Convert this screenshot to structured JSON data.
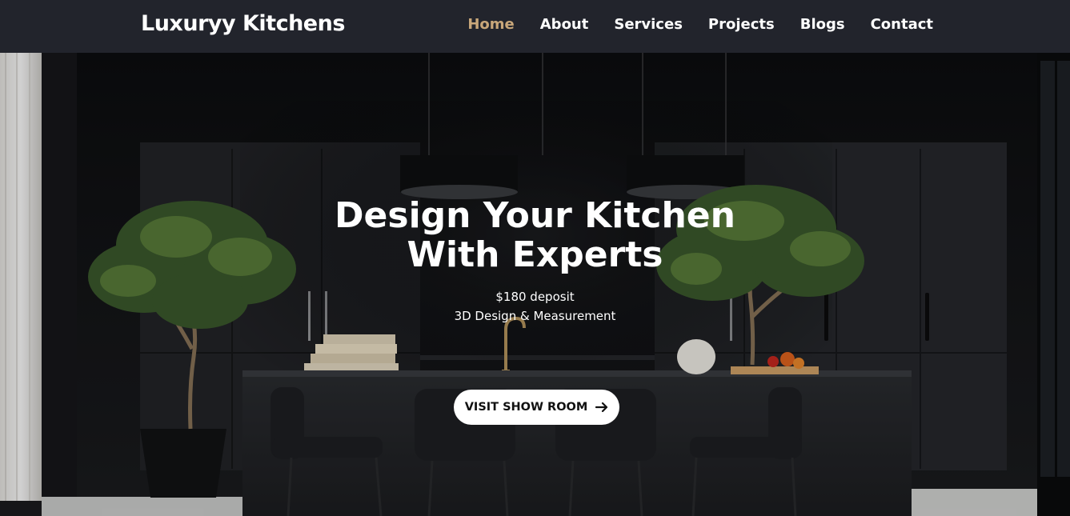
{
  "header": {
    "brand": "Luxuryy Kitchens",
    "nav": [
      {
        "label": "Home",
        "active": true
      },
      {
        "label": "About",
        "active": false
      },
      {
        "label": "Services",
        "active": false
      },
      {
        "label": "Projects",
        "active": false
      },
      {
        "label": "Blogs",
        "active": false
      },
      {
        "label": "Contact",
        "active": false
      }
    ]
  },
  "hero": {
    "title_line1": "Design Your Kitchen",
    "title_line2": "With Experts",
    "subtitle_line1": "$180 deposit",
    "subtitle_line2": "3D Design & Measurement",
    "cta_label": "VISIT SHOW ROOM",
    "cta_icon": "arrow-right-icon"
  },
  "colors": {
    "header_bg": "#22242c",
    "nav_active": "#c9a77a",
    "nav_text": "#ffffff",
    "cta_bg": "#ffffff",
    "cta_text": "#111111"
  }
}
